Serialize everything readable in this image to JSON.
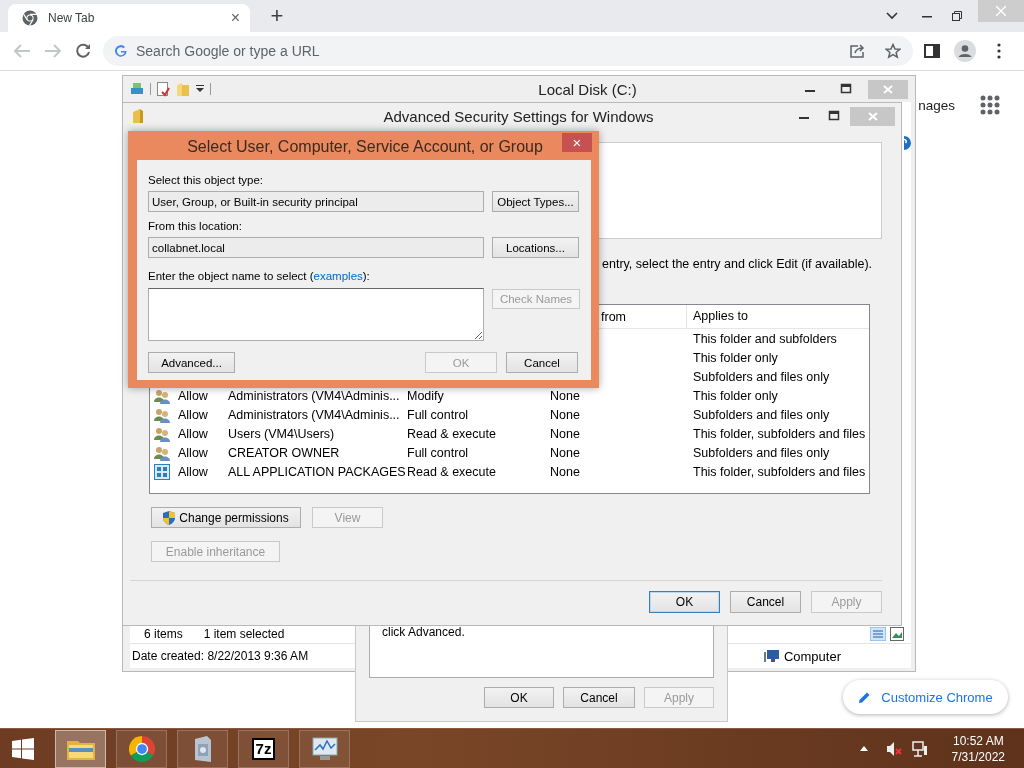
{
  "browser": {
    "tabs": [
      {
        "title": "New Tab",
        "close": "×",
        "selected": true
      }
    ],
    "new_tab": "+",
    "omnibox": {
      "placeholder": "Search Google or type a URL"
    },
    "page": {
      "partial_link": "nages",
      "customize_button": "Customize Chrome"
    }
  },
  "explorer": {
    "title": "Local Disk (C:)",
    "status": {
      "item_count": "6 items",
      "selection": "1 item selected",
      "date_created": "Date created: 8/22/2013 9:36 AM",
      "location": "Computer"
    }
  },
  "properties_dialog": {
    "text": "click Advanced.",
    "buttons": [
      {
        "label": "OK",
        "disabled": false
      },
      {
        "label": "Cancel",
        "disabled": false
      },
      {
        "label": "Apply",
        "disabled": true
      }
    ]
  },
  "advanced_security": {
    "title": "Advanced Security Settings for Windows",
    "instruction": "entry, select the entry and click Edit (if available).",
    "table": {
      "columns": [
        "from",
        "Applies to"
      ],
      "rows": [
        {
          "applies_to": "This folder and subfolders"
        },
        {
          "applies_to": "This folder only"
        },
        {
          "applies_to": "Subfolders and files only"
        },
        {
          "kind": "group",
          "type": "Allow",
          "principal": "Administrators (VM4\\Adminis...",
          "access": "Modify",
          "inherited_from": "None",
          "applies_to": "This folder only"
        },
        {
          "kind": "group",
          "type": "Allow",
          "principal": "Administrators (VM4\\Adminis...",
          "access": "Full control",
          "inherited_from": "None",
          "applies_to": "Subfolders and files only"
        },
        {
          "kind": "group",
          "type": "Allow",
          "principal": "Users (VM4\\Users)",
          "access": "Read & execute",
          "inherited_from": "None",
          "applies_to": "This folder, subfolders and files"
        },
        {
          "kind": "group",
          "type": "Allow",
          "principal": "CREATOR OWNER",
          "access": "Full control",
          "inherited_from": "None",
          "applies_to": "Subfolders and files only"
        },
        {
          "kind": "package",
          "type": "Allow",
          "principal": "ALL APPLICATION PACKAGES",
          "access": "Read & execute",
          "inherited_from": "None",
          "applies_to": "This folder, subfolders and files"
        }
      ]
    },
    "actions": [
      {
        "label": "Change permissions",
        "shield": true,
        "disabled": false
      },
      {
        "label": "View",
        "shield": false,
        "disabled": true
      },
      {
        "label": "Enable inheritance",
        "shield": false,
        "disabled": true
      }
    ],
    "buttons": [
      {
        "label": "OK",
        "default": true,
        "disabled": false
      },
      {
        "label": "Cancel",
        "default": false,
        "disabled": false
      },
      {
        "label": "Apply",
        "default": false,
        "disabled": true
      }
    ]
  },
  "select_dialog": {
    "title": "Select User, Computer, Service Account, or Group",
    "close": "×",
    "object_type_label": "Select this object type:",
    "object_type": "User, Group, or Built-in security principal",
    "object_types_button": {
      "label": "Object Types...",
      "disabled": false
    },
    "location_label": "From this location:",
    "location": "collabnet.local",
    "locations_button": {
      "label": "Locations...",
      "disabled": false
    },
    "name_label": {
      "before": "Enter the object name to select (",
      "link": "examples",
      "after": "):"
    },
    "check_names_button": {
      "label": "Check Names",
      "disabled": true
    },
    "buttons": [
      {
        "label": "Advanced...",
        "disabled": false
      },
      {
        "label": "OK",
        "disabled": true
      },
      {
        "label": "Cancel",
        "disabled": false
      }
    ]
  },
  "taskbar": {
    "apps": [
      {
        "kind": "folder",
        "selected": true
      },
      {
        "kind": "browser",
        "selected": false
      },
      {
        "kind": "installer",
        "selected": false
      },
      {
        "kind": "archive",
        "label": "7z",
        "selected": false
      },
      {
        "kind": "monitor",
        "selected": false
      }
    ],
    "clock": {
      "time": "10:52 AM",
      "date": "7/31/2022"
    }
  }
}
